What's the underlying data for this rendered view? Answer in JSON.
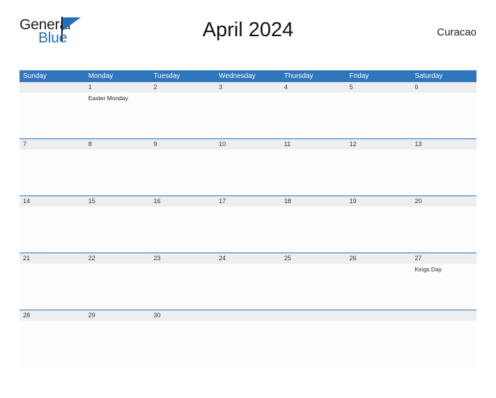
{
  "brand": {
    "name_part1": "General",
    "name_part2": "Blue",
    "flag_icon": "flag-icon",
    "accent_color": "#2170b8"
  },
  "header": {
    "title": "April 2024",
    "location": "Curacao"
  },
  "theme": {
    "header_blue": "#3076bc",
    "rule_blue": "#2170b8",
    "date_band_gray": "#eeeeee"
  },
  "calendar": {
    "month": "April",
    "year": "2024",
    "weekday_headers": [
      "Sunday",
      "Monday",
      "Tuesday",
      "Wednesday",
      "Thursday",
      "Friday",
      "Saturday"
    ],
    "weeks": [
      {
        "days": [
          {
            "num": "",
            "events": []
          },
          {
            "num": "1",
            "events": [
              "Easter Monday"
            ]
          },
          {
            "num": "2",
            "events": []
          },
          {
            "num": "3",
            "events": []
          },
          {
            "num": "4",
            "events": []
          },
          {
            "num": "5",
            "events": []
          },
          {
            "num": "6",
            "events": []
          }
        ]
      },
      {
        "days": [
          {
            "num": "7",
            "events": []
          },
          {
            "num": "8",
            "events": []
          },
          {
            "num": "9",
            "events": []
          },
          {
            "num": "10",
            "events": []
          },
          {
            "num": "11",
            "events": []
          },
          {
            "num": "12",
            "events": []
          },
          {
            "num": "13",
            "events": []
          }
        ]
      },
      {
        "days": [
          {
            "num": "14",
            "events": []
          },
          {
            "num": "15",
            "events": []
          },
          {
            "num": "16",
            "events": []
          },
          {
            "num": "17",
            "events": []
          },
          {
            "num": "18",
            "events": []
          },
          {
            "num": "19",
            "events": []
          },
          {
            "num": "20",
            "events": []
          }
        ]
      },
      {
        "days": [
          {
            "num": "21",
            "events": []
          },
          {
            "num": "22",
            "events": []
          },
          {
            "num": "23",
            "events": []
          },
          {
            "num": "24",
            "events": []
          },
          {
            "num": "25",
            "events": []
          },
          {
            "num": "26",
            "events": []
          },
          {
            "num": "27",
            "events": [
              "Kings Day"
            ]
          }
        ]
      },
      {
        "days": [
          {
            "num": "28",
            "events": []
          },
          {
            "num": "29",
            "events": []
          },
          {
            "num": "30",
            "events": []
          },
          {
            "num": "",
            "events": []
          },
          {
            "num": "",
            "events": []
          },
          {
            "num": "",
            "events": []
          },
          {
            "num": "",
            "events": []
          }
        ]
      }
    ]
  }
}
